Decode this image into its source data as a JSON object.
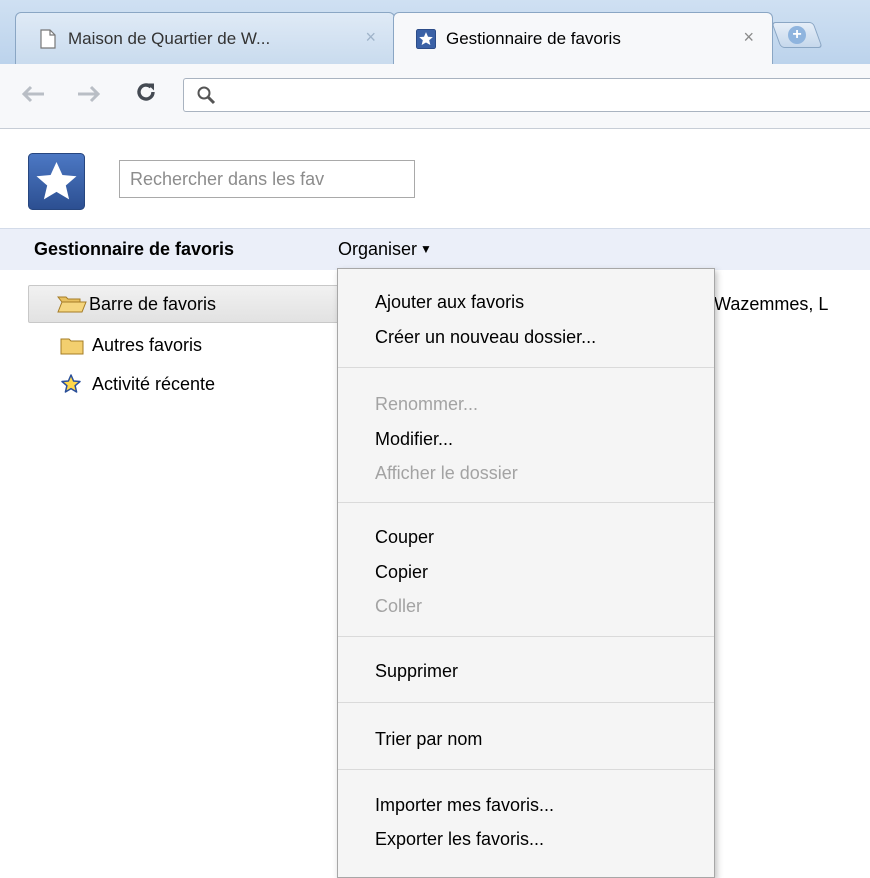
{
  "tabs": [
    {
      "title": "Maison de Quartier de W...",
      "active": false
    },
    {
      "title": "Gestionnaire de favoris",
      "active": true
    }
  ],
  "tab_close_glyph": "×",
  "icons": {
    "back": "arrow-left-icon",
    "forward": "arrow-right-icon",
    "reload": "reload-icon",
    "search": "magnifier-icon",
    "new_tab": "plus-icon",
    "logo": "star-icon",
    "folder_open": "folder-open-icon",
    "folder": "folder-icon",
    "recent": "star-outline-icon"
  },
  "search": {
    "placeholder": "Rechercher dans les fav",
    "value": ""
  },
  "header": {
    "title": "Gestionnaire de favoris",
    "organize_label": "Organiser"
  },
  "tree": [
    {
      "label": "Barre de favoris",
      "icon": "folder-open-icon",
      "selected": true
    },
    {
      "label": "Autres favoris",
      "icon": "folder-icon",
      "selected": false
    },
    {
      "label": "Activité récente",
      "icon": "star-outline-icon",
      "selected": false
    }
  ],
  "list_snippet": "Wazemmes, L",
  "menu": {
    "groups": [
      [
        {
          "label": "Ajouter aux favoris",
          "enabled": true
        },
        {
          "label": "Créer un nouveau dossier...",
          "enabled": true
        }
      ],
      [
        {
          "label": "Renommer...",
          "enabled": false
        },
        {
          "label": "Modifier...",
          "enabled": true
        },
        {
          "label": "Afficher le dossier",
          "enabled": false
        }
      ],
      [
        {
          "label": "Couper",
          "enabled": true
        },
        {
          "label": "Copier",
          "enabled": true
        },
        {
          "label": "Coller",
          "enabled": false
        }
      ],
      [
        {
          "label": "Supprimer",
          "enabled": true
        }
      ],
      [
        {
          "label": "Trier par nom",
          "enabled": true
        }
      ],
      [
        {
          "label": "Importer mes favoris...",
          "enabled": true
        },
        {
          "label": "Exporter les favoris...",
          "enabled": true
        }
      ]
    ]
  },
  "colors": {
    "tabstrip": "#c6d9ee",
    "header_bar": "#ebeff9",
    "logo": "#3c64a8",
    "disabled_text": "#a3a3a3",
    "menu_bg": "#f5f5f5"
  }
}
